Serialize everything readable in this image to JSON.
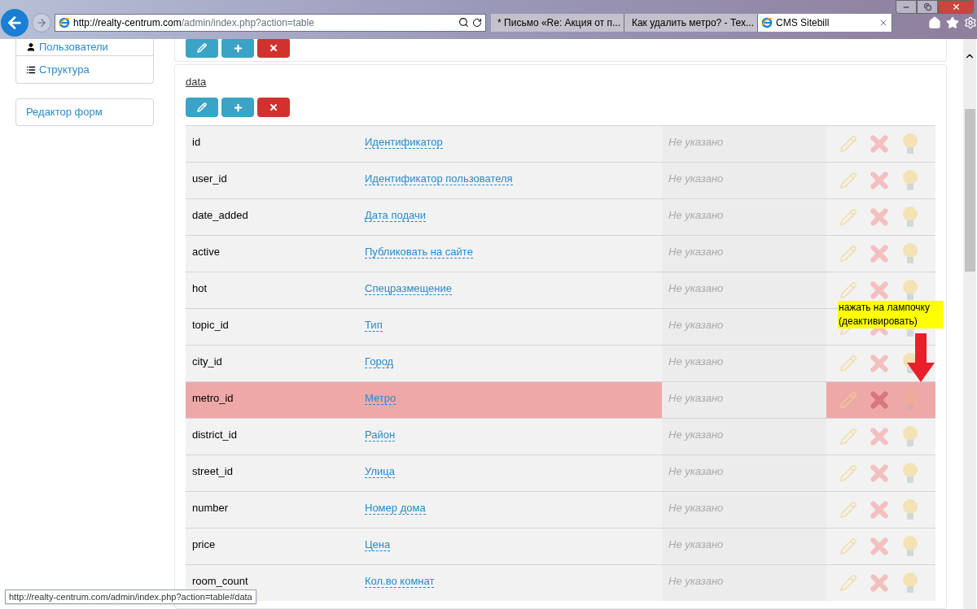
{
  "browser": {
    "address": {
      "host": "http://realty-centrum.com",
      "path": "/admin/index.php?action=table"
    },
    "tabs": [
      {
        "label": "* Письмо «Re: Акция от п...",
        "selected": false,
        "kind": "mail"
      },
      {
        "label": "Как удалить метро? - Тех...",
        "selected": false,
        "kind": "site"
      },
      {
        "label": "CMS Sitebill",
        "selected": true,
        "kind": "ie"
      }
    ],
    "status_tooltip": "http://realty-centrum.com/admin/index.php?action=table#data"
  },
  "sidebar": {
    "items": [
      {
        "label": "Пользователи",
        "kind": "user"
      },
      {
        "label": "Структура",
        "kind": "list"
      }
    ],
    "form_editor": "Редактор форм"
  },
  "table_link": "data",
  "rows": [
    {
      "name": "id",
      "title": "Идентификатор",
      "value": "Не указано",
      "highlighted": false
    },
    {
      "name": "user_id",
      "title": "Идентификатор пользователя",
      "value": "Не указано",
      "highlighted": false
    },
    {
      "name": "date_added",
      "title": "Дата подачи",
      "value": "Не указано",
      "highlighted": false
    },
    {
      "name": "active",
      "title": "Публиковать на сайте",
      "value": "Не указано",
      "highlighted": false
    },
    {
      "name": "hot",
      "title": "Спецразмещение",
      "value": "Не указано",
      "highlighted": false
    },
    {
      "name": "topic_id",
      "title": "Тип",
      "value": "Не указано",
      "highlighted": false
    },
    {
      "name": "city_id",
      "title": "Город",
      "value": "Не указано",
      "highlighted": false
    },
    {
      "name": "metro_id",
      "title": "Метро",
      "value": "Не указано",
      "highlighted": true
    },
    {
      "name": "district_id",
      "title": "Район",
      "value": "Не указано",
      "highlighted": false
    },
    {
      "name": "street_id",
      "title": "Улица",
      "value": "Не указано",
      "highlighted": false
    },
    {
      "name": "number",
      "title": "Номер дома",
      "value": "Не указано",
      "highlighted": false
    },
    {
      "name": "price",
      "title": "Цена",
      "value": "Не указано",
      "highlighted": false
    },
    {
      "name": "room_count",
      "title": "Кол.во комнат",
      "value": "Не указано",
      "highlighted": false
    }
  ],
  "annotation": "нажать на лампочку (деактивировать)"
}
